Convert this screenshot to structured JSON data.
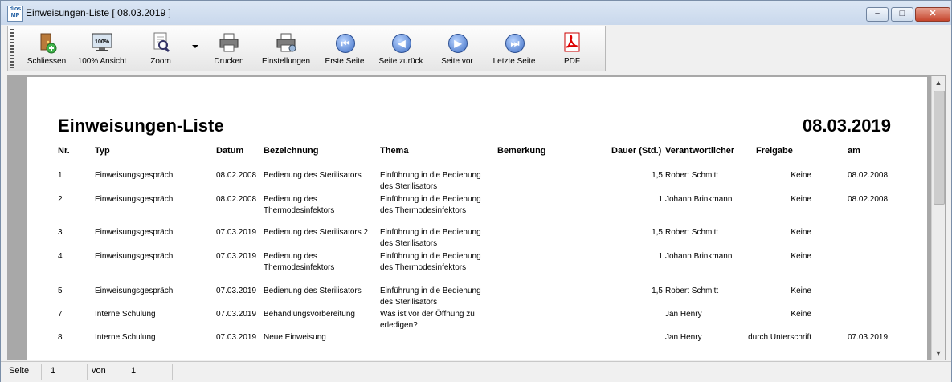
{
  "window": {
    "title": "Einweisungen-Liste [ 08.03.2019 ]",
    "icon_text": "dios MP",
    "minimize": "–",
    "maximize": "□",
    "close": "✕"
  },
  "toolbar": {
    "close": "Schliessen",
    "zoom100": "100% Ansicht",
    "zoom": "Zoom",
    "print": "Drucken",
    "settings": "Einstellungen",
    "first": "Erste Seite",
    "prev": "Seite zurück",
    "next": "Seite vor",
    "last": "Letzte Seite",
    "pdf": "PDF"
  },
  "report": {
    "title": "Einweisungen-Liste",
    "date": "08.03.2019",
    "columns": [
      "Nr.",
      "Typ",
      "Datum",
      "Bezeichnung",
      "Thema",
      "Bemerkung",
      "Dauer (Std.)",
      "Verantwortlicher",
      "Freigabe",
      "am"
    ],
    "rows": [
      {
        "nr": "1",
        "typ": "Einweisungsgespräch",
        "datum": "08.02.2008",
        "bez1": "Bedienung des Sterilisators",
        "bez2": "",
        "thema1": "Einführung in die Bedienung",
        "thema2": "des Sterilisators",
        "bemerkung": "",
        "dauer": "1,5",
        "verantw": "Robert Schmitt",
        "freigabe": "Keine",
        "am": "08.02.2008"
      },
      {
        "nr": "2",
        "typ": "Einweisungsgespräch",
        "datum": "08.02.2008",
        "bez1": "Bedienung des",
        "bez2": "Thermodesinfektors",
        "thema1": "Einführung in die Bedienung",
        "thema2": "des Thermodesinfektors",
        "bemerkung": "",
        "dauer": "1",
        "verantw": "Johann Brinkmann",
        "freigabe": "Keine",
        "am": "08.02.2008"
      },
      {
        "nr": "3",
        "typ": "Einweisungsgespräch",
        "datum": "07.03.2019",
        "bez1": "Bedienung des Sterilisators 2",
        "bez2": "",
        "thema1": "Einführung in die Bedienung",
        "thema2": "des Sterilisators",
        "bemerkung": "",
        "dauer": "1,5",
        "verantw": "Robert Schmitt",
        "freigabe": "Keine",
        "am": ""
      },
      {
        "nr": "4",
        "typ": "Einweisungsgespräch",
        "datum": "07.03.2019",
        "bez1": "Bedienung des",
        "bez2": "Thermodesinfektors",
        "thema1": "Einführung in die Bedienung",
        "thema2": "des Thermodesinfektors",
        "bemerkung": "",
        "dauer": "1",
        "verantw": "Johann Brinkmann",
        "freigabe": "Keine",
        "am": ""
      },
      {
        "nr": "5",
        "typ": "Einweisungsgespräch",
        "datum": "07.03.2019",
        "bez1": "Bedienung des Sterilisators",
        "bez2": "",
        "thema1": "Einführung in die Bedienung",
        "thema2": "des Sterilisators",
        "bemerkung": "",
        "dauer": "1,5",
        "verantw": "Robert Schmitt",
        "freigabe": "Keine",
        "am": ""
      },
      {
        "nr": "7",
        "typ": "Interne Schulung",
        "datum": "07.03.2019",
        "bez1": "Behandlungsvorbereitung",
        "bez2": "",
        "thema1": "Was ist vor der Öffnung zu",
        "thema2": "erledigen?",
        "bemerkung": "",
        "dauer": "",
        "verantw": "Jan Henry",
        "freigabe": "Keine",
        "am": ""
      },
      {
        "nr": "8",
        "typ": "Interne Schulung",
        "datum": "07.03.2019",
        "bez1": "Neue Einweisung",
        "bez2": "",
        "thema1": "",
        "thema2": "",
        "bemerkung": "",
        "dauer": "",
        "verantw": "Jan Henry",
        "freigabe": "durch Unterschrift",
        "am": "07.03.2019"
      }
    ]
  },
  "status": {
    "page_label": "Seite",
    "page_value": "1",
    "of_label": "von",
    "of_value": "1"
  }
}
